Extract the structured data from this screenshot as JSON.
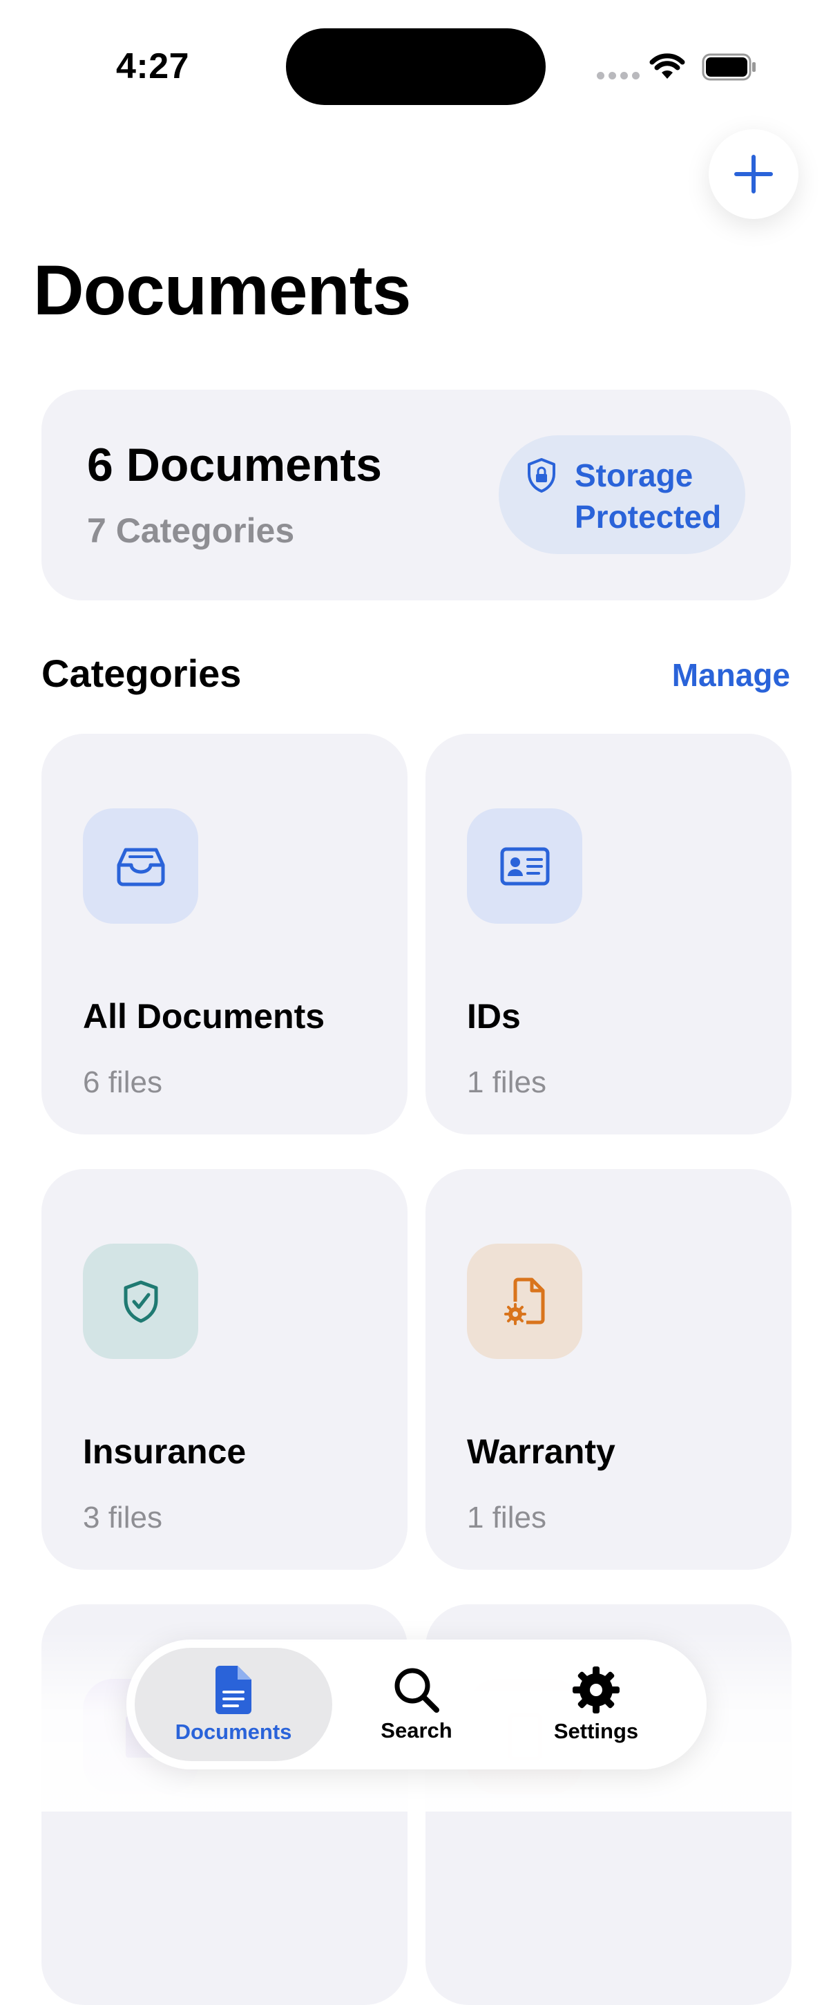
{
  "status_bar": {
    "time": "4:27"
  },
  "header": {
    "title": "Documents",
    "add_button_icon": "plus-icon"
  },
  "summary": {
    "documents_label": "6 Documents",
    "categories_label": "7 Categories",
    "storage_line1": "Storage",
    "storage_line2": "Protected",
    "storage_icon": "lock-shield-icon"
  },
  "categories_section": {
    "title": "Categories",
    "manage_label": "Manage"
  },
  "categories": [
    {
      "name": "All Documents",
      "count": "6 files",
      "icon": "tray-icon",
      "color": "#2a63d9",
      "bg": "#dbe3f7"
    },
    {
      "name": "IDs",
      "count": "1 files",
      "icon": "id-card-icon",
      "color": "#2a63d9",
      "bg": "#dbe3f7"
    },
    {
      "name": "Insurance",
      "count": "3 files",
      "icon": "checkmark-shield-icon",
      "color": "#1f7a72",
      "bg": "#d3e4e5"
    },
    {
      "name": "Warranty",
      "count": "1 files",
      "icon": "doc-gear-icon",
      "color": "#d9741c",
      "bg": "#efe1d5"
    }
  ],
  "tabbar": {
    "tabs": [
      {
        "label": "Documents",
        "icon": "document-icon",
        "active": true
      },
      {
        "label": "Search",
        "icon": "magnifying-glass-icon",
        "active": false
      },
      {
        "label": "Settings",
        "icon": "gear-icon",
        "active": false
      }
    ]
  },
  "colors": {
    "accent": "#2a63d9",
    "card_bg": "#f2f2f7",
    "secondary_text": "#8e8e93"
  }
}
